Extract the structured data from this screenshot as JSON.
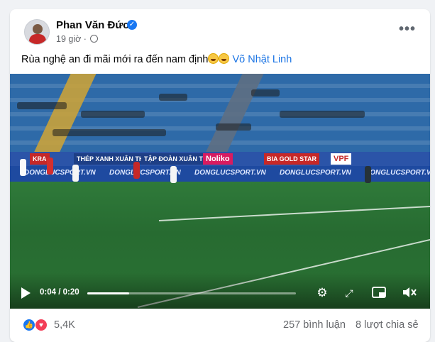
{
  "post": {
    "author": "Phan Văn Đức",
    "time": "19 giờ",
    "separator": "·",
    "text": "Rùa nghệ an đi mãi mới ra đến nam định",
    "mention": "Võ Nhật Linh",
    "more_label": "•••"
  },
  "video": {
    "ads": [
      "KRA",
      "THÉP XANH XUÂN THIỆN",
      "TẬP ĐOÀN XUÂN THIỆN",
      "Noliko",
      "BIA GOLD STAR",
      "VPF"
    ],
    "ad_repeat": "DONGLUCSPORT.VN",
    "current_time": "0:04",
    "duration": "0:20",
    "time_display": "0:04 / 0:20",
    "progress": 0.2,
    "controls": {
      "settings_icon": "gear-icon",
      "fullscreen_icon": "expand-icon",
      "miniplayer_icon": "picture-in-picture-icon",
      "volume_icon": "speaker-muted-icon"
    }
  },
  "stats": {
    "reactions_count": "5,4K",
    "comments": "257 bình luận",
    "shares": "8 lượt chia sẻ"
  },
  "colors": {
    "accent": "#1877f2",
    "mention": "#1b74e4",
    "like": "#1877f2",
    "love": "#f33e58"
  }
}
